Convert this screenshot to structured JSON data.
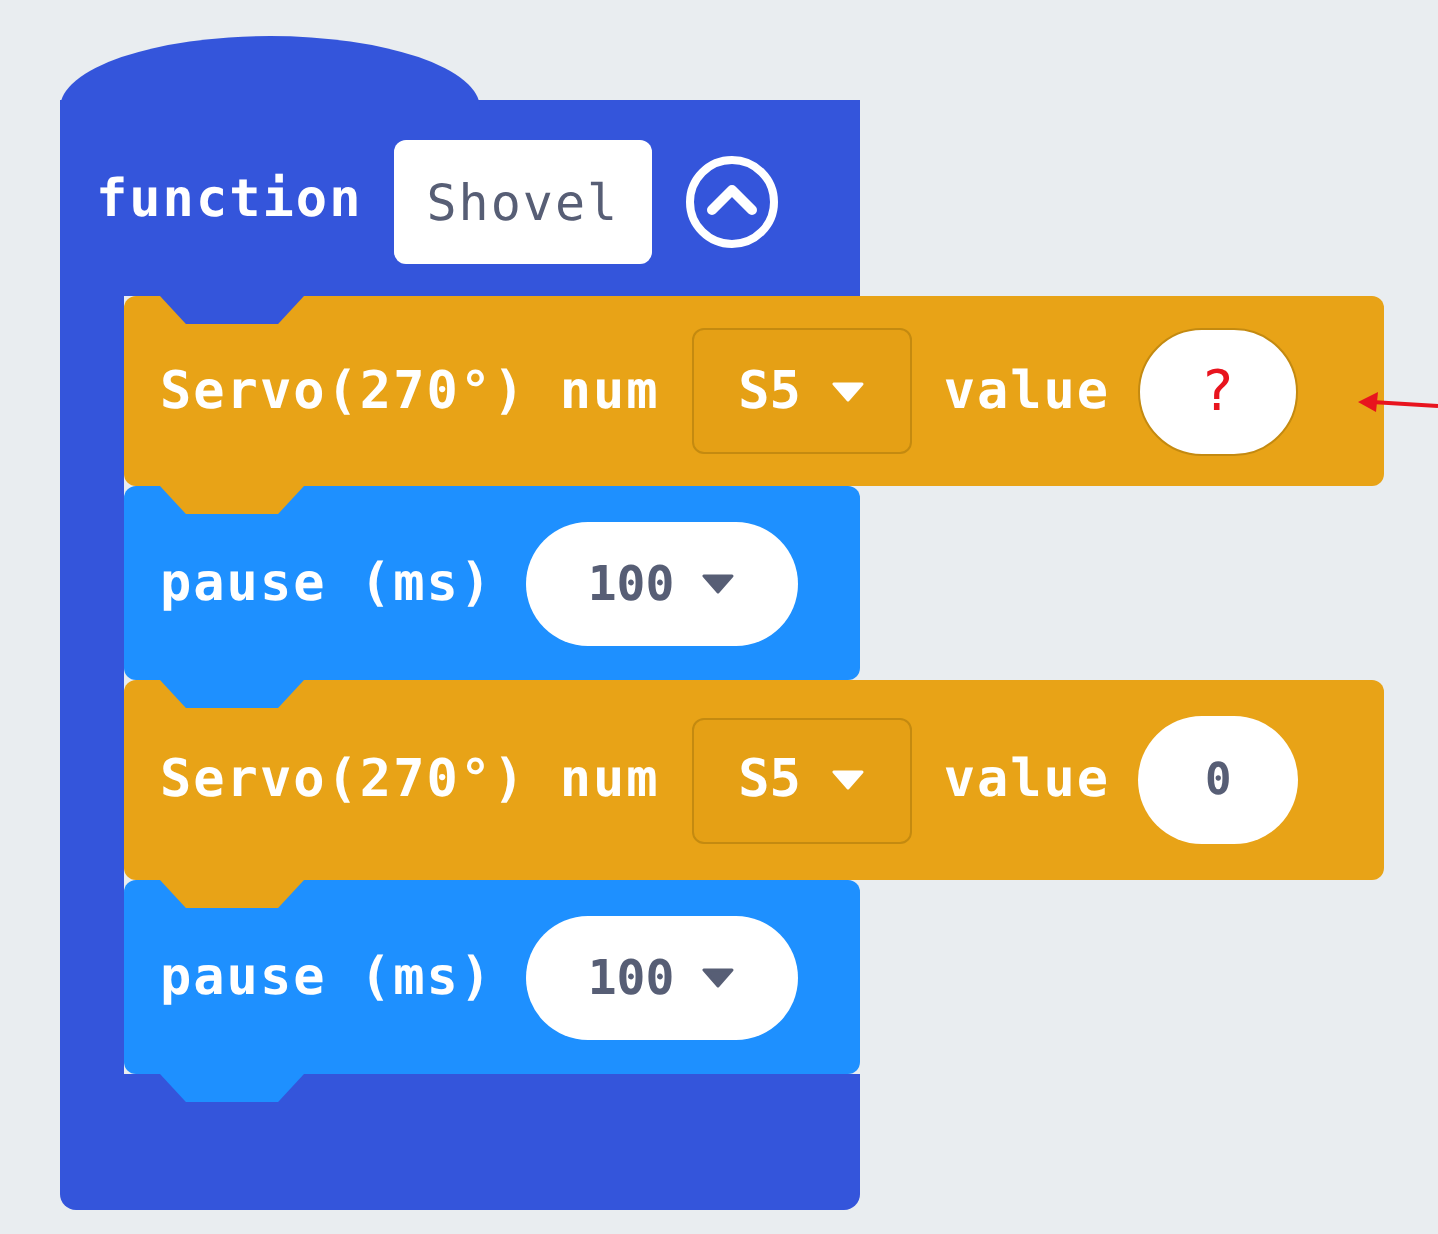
{
  "function": {
    "keyword": "function",
    "name": "Shovel"
  },
  "blocks": [
    {
      "kind": "servo",
      "label": "Servo(270°) num",
      "pin": "S5",
      "value_label": "value",
      "value": "?",
      "highlighted": true
    },
    {
      "kind": "pause",
      "label": "pause (ms)",
      "value": "100"
    },
    {
      "kind": "servo",
      "label": "Servo(270°) num",
      "pin": "S5",
      "value_label": "value",
      "value": "0",
      "highlighted": false
    },
    {
      "kind": "pause",
      "label": "pause (ms)",
      "value": "100"
    }
  ]
}
